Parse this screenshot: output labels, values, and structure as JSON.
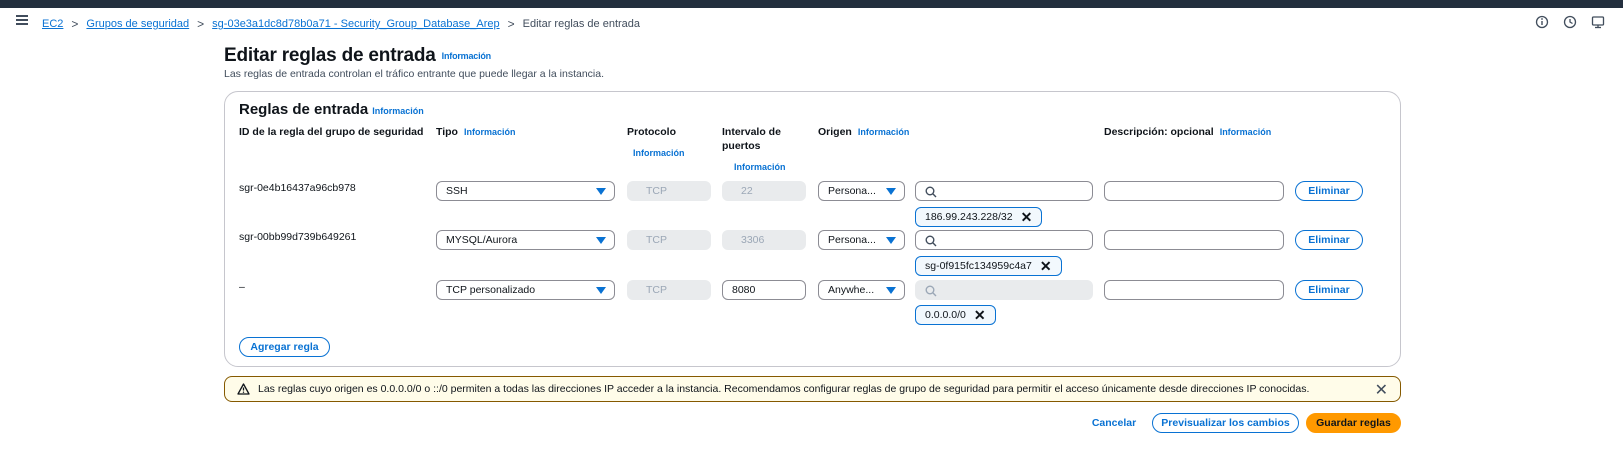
{
  "breadcrumb": {
    "items": [
      "EC2",
      "Grupos de seguridad",
      "sg-03e3a1dc8d78b0a71 - Security_Group_Database_Arep"
    ],
    "current": "Editar reglas de entrada",
    "separator": ">"
  },
  "page": {
    "title": "Editar reglas de entrada",
    "info": "Información",
    "description": "Las reglas de entrada controlan el tráfico entrante que puede llegar a la instancia."
  },
  "rules": {
    "title": "Reglas de entrada",
    "info": "Información",
    "headers": {
      "id": "ID de la regla del grupo de seguridad",
      "type": "Tipo",
      "protocol": "Protocolo",
      "ports": "Intervalo de puertos",
      "origin": "Origen",
      "description": "Descripción: opcional",
      "info": "Información"
    },
    "rows": [
      {
        "id": "sgr-0e4b16437a96cb978",
        "type": "SSH",
        "protocol": "TCP",
        "ports": "22",
        "origin": "Persona...",
        "source_token": "186.99.243.228/32",
        "description": "",
        "delete": "Eliminar"
      },
      {
        "id": "sgr-00bb99d739b649261",
        "type": "MYSQL/Aurora",
        "protocol": "TCP",
        "ports": "3306",
        "origin": "Persona...",
        "source_token": "sg-0f915fc134959c4a7",
        "description": "",
        "delete": "Eliminar"
      },
      {
        "id": "–",
        "type": "TCP personalizado",
        "protocol": "TCP",
        "ports": "8080",
        "origin": "Anywhe...",
        "source_token": "0.0.0.0/0",
        "description": "",
        "delete": "Eliminar"
      }
    ],
    "add_rule": "Agregar regla"
  },
  "alert": {
    "text": "Las reglas cuyo origen es 0.0.0.0/0 o ::/0 permiten a todas las direcciones IP acceder a la instancia. Recomendamos configurar reglas de grupo de seguridad para permitir el acceso únicamente desde direcciones IP conocidas."
  },
  "footer": {
    "cancel": "Cancelar",
    "preview": "Previsualizar los cambios",
    "save": "Guardar reglas"
  },
  "colors": {
    "link": "#0972d3",
    "primary": "#ff9900",
    "warning_border": "#855900",
    "warning_bg": "#fffce9",
    "topbar": "#232f3e"
  }
}
